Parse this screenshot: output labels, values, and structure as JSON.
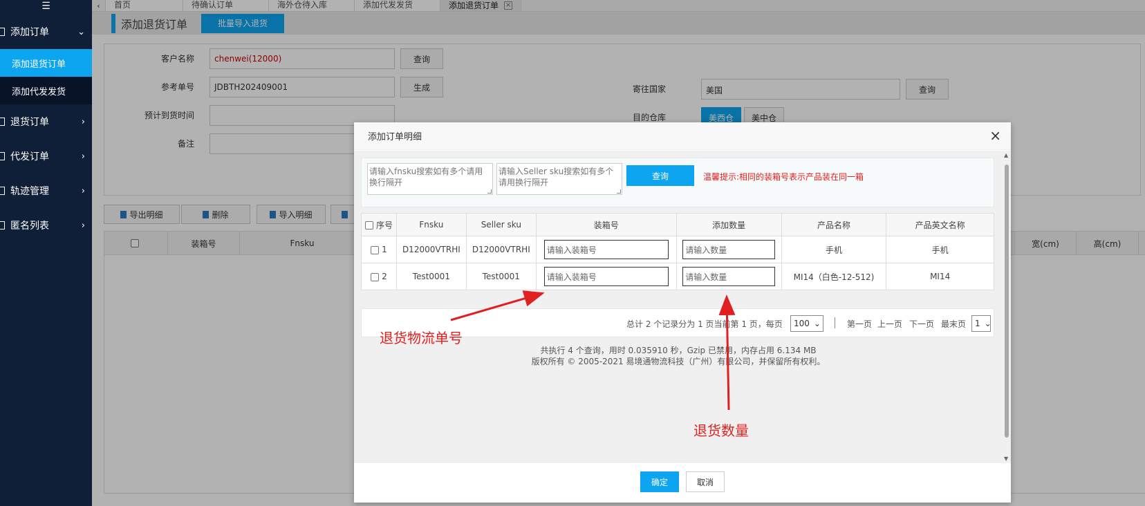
{
  "sidebar": {
    "menu_icon": "☰",
    "items": [
      {
        "label": "添加订单",
        "chev": "⌄"
      },
      {
        "label": "退货订单",
        "chev": "›"
      },
      {
        "label": "代发订单",
        "chev": "›"
      },
      {
        "label": "轨迹管理",
        "chev": "›"
      },
      {
        "label": "匿名列表",
        "chev": "›"
      }
    ],
    "subs": [
      {
        "label": "添加退货订单"
      },
      {
        "label": "添加代发发货"
      }
    ]
  },
  "tabs": {
    "back": "‹",
    "items": [
      "首页",
      "待确认订单",
      "海外仓待入库",
      "添加代发发货",
      "添加退货订单"
    ],
    "close": "×"
  },
  "page": {
    "title": "添加退货订单",
    "batch_import": "批量导入退货"
  },
  "form": {
    "customer_label": "客户名称",
    "customer_value": "chenwei(12000)",
    "query": "查询",
    "ref_label": "参考单号",
    "ref_value": "JDBTH202409001",
    "generate": "生成",
    "eta_label": "预计到货时间",
    "remark_label": "备注",
    "country_label": "寄往国家",
    "country_value": "美国",
    "warehouse_label": "目的仓库",
    "warehouse_options": [
      "美西仓",
      "美中仓"
    ]
  },
  "toolbar": {
    "export": "导出明细",
    "delete": "删除",
    "import": "导入明细"
  },
  "grid": {
    "headers": [
      "装箱号",
      "Fnsku",
      "宽(cm)",
      "高(cm)"
    ]
  },
  "modal": {
    "title": "添加订单明细",
    "close": "×",
    "fnsku_placeholder": "请输入fnsku搜索如有多个请用换行隔开",
    "sellersku_placeholder": "请输入Seller sku搜索如有多个请用换行隔开",
    "query": "查询",
    "tip": "温馨提示:相同的装箱号表示产品装在同一箱",
    "columns": [
      "序号",
      "Fnsku",
      "Seller sku",
      "装箱号",
      "添加数量",
      "产品名称",
      "产品英文名称"
    ],
    "rows": [
      {
        "no": "1",
        "fnsku": "D12000VTRHI",
        "sellersku": "D12000VTRHI",
        "box_placeholder": "请输入装箱号",
        "qty_placeholder": "请输入数量",
        "name": "手机",
        "name_en": "手机"
      },
      {
        "no": "2",
        "fnsku": "Test0001",
        "sellersku": "Test0001",
        "box_placeholder": "请输入装箱号",
        "qty_placeholder": "请输入数量",
        "name": "MI14（白色-12-512)",
        "name_en": "MI14"
      }
    ],
    "pager": {
      "summary": "总计 2 个记录分为 1 页当前第 1 页，每页",
      "per_page": "100",
      "first": "第一页",
      "prev": "上一页",
      "next": "下一页",
      "last": "最末页",
      "page": "1"
    },
    "footer_line1": "共执行 4 个查询，用时 0.035910 秒，Gzip 已禁用，内存占用 6.134 MB",
    "footer_line2": "版权所有 © 2005-2021 易境通物流科技（广州）有限公司，并保留所有权利。",
    "ok": "确定",
    "cancel": "取消"
  },
  "annotations": {
    "tracking": "退货物流单号",
    "quantity": "退货数量",
    "color": "#e02020"
  }
}
